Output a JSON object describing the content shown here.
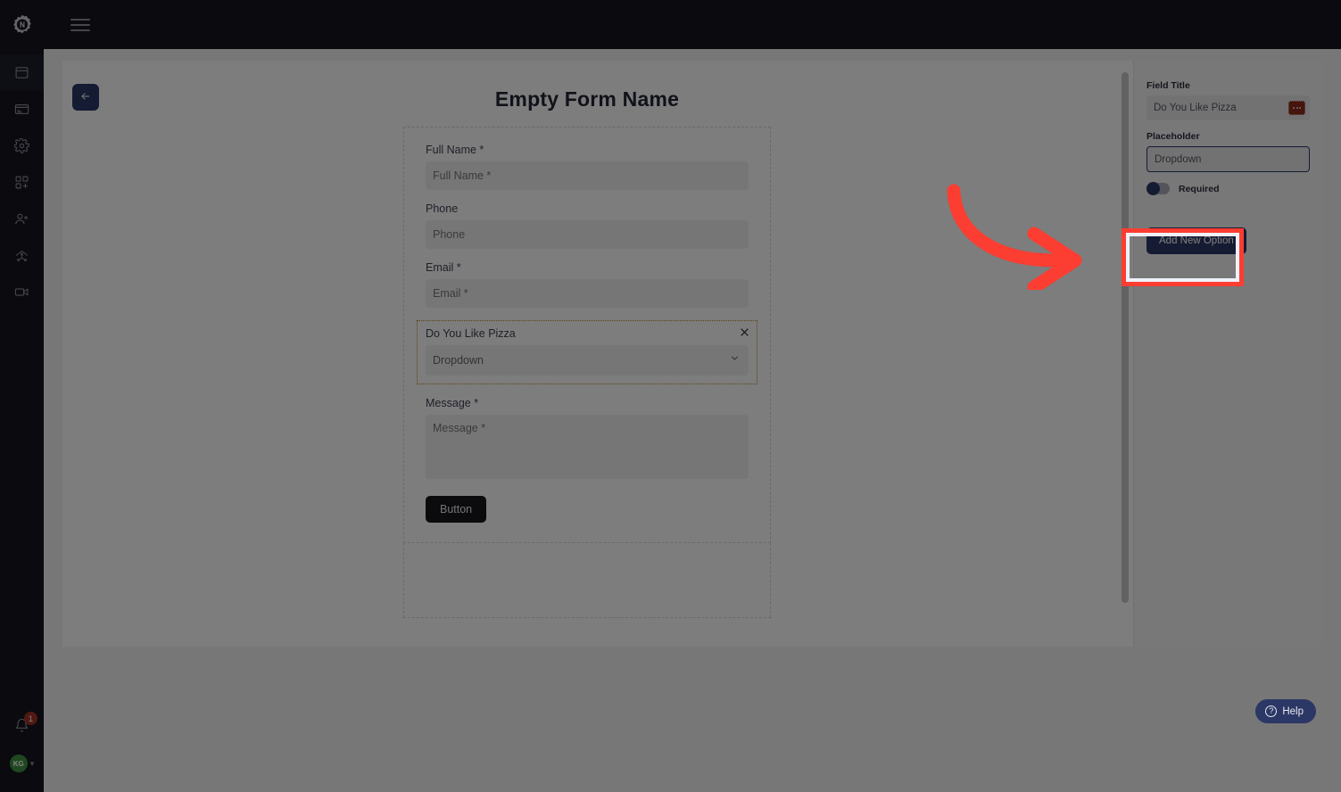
{
  "app": {
    "logo_name": "nectar-logo",
    "theme": {
      "sidebar_bg": "#14141f",
      "accent": "#2b3765",
      "highlight_red": "#fc3d31",
      "selected_field_border": "#b8862b",
      "avatar_green": "#3f9142",
      "badge_red": "#a33226"
    }
  },
  "sidebar": {
    "items": [
      {
        "label": "Pages",
        "icon": "window-icon",
        "active": true
      },
      {
        "label": "Forms",
        "icon": "card-list-icon",
        "active": false
      },
      {
        "label": "Settings",
        "icon": "gear-icon",
        "active": false
      },
      {
        "label": "Widgets",
        "icon": "widgets-icon",
        "active": false
      },
      {
        "label": "Add User",
        "icon": "add-user-icon",
        "active": false
      },
      {
        "label": "Sitemap",
        "icon": "sitemap-icon",
        "active": false
      },
      {
        "label": "Video",
        "icon": "video-camera-icon",
        "active": false
      }
    ],
    "notifications": {
      "icon": "bell-icon",
      "count": "1"
    },
    "user": {
      "initials": "KG",
      "caret": "chevron-down-icon"
    }
  },
  "topbar": {
    "menu_icon": "hamburger-menu-icon"
  },
  "canvas": {
    "back_button": {
      "icon": "arrow-left-icon",
      "label": "Back"
    },
    "form": {
      "title": "Empty Form Name",
      "fields": [
        {
          "type": "text",
          "label": "Full Name *",
          "placeholder": "Full Name *",
          "selected": false
        },
        {
          "type": "text",
          "label": "Phone",
          "placeholder": "Phone",
          "selected": false
        },
        {
          "type": "text",
          "label": "Email *",
          "placeholder": "Email *",
          "selected": false
        },
        {
          "type": "dropdown",
          "label": "Do You Like Pizza",
          "placeholder": "Dropdown",
          "selected": true,
          "remove_icon": "close-icon",
          "chevron": "chevron-down-icon"
        },
        {
          "type": "textarea",
          "label": "Message *",
          "placeholder": "Message *",
          "selected": false
        }
      ],
      "submit_label": "Button"
    },
    "scrollbar": {
      "name": "canvas-vertical-scrollbar"
    }
  },
  "settings_panel": {
    "field_title_label": "Field Title",
    "field_title_value": "Do You Like Pizza",
    "field_title_menu_icon": "ellipsis-icon",
    "placeholder_label": "Placeholder",
    "placeholder_value": "Dropdown",
    "required_label": "Required",
    "required_on": false,
    "add_new_option_label": "Add New Option"
  },
  "annotations": {
    "arrow": "curved-red-arrow-pointing-right",
    "highlight_target": "Add New Option"
  },
  "help": {
    "label": "Help",
    "icon": "question-mark-icon"
  }
}
